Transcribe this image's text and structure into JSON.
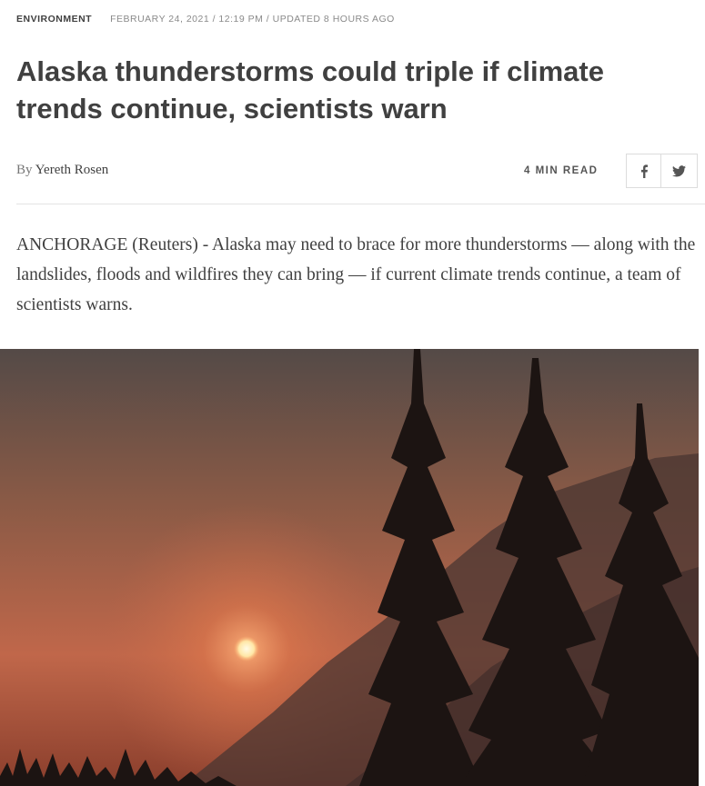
{
  "article": {
    "section": "ENVIRONMENT",
    "timestamp": "FEBRUARY 24, 2021 / 12:19 PM / UPDATED 8 HOURS AGO",
    "headline": "Alaska thunderstorms could triple if climate trends continue, scientists warn",
    "byline_prefix": "By",
    "author": "Yereth Rosen",
    "read_time": "4 MIN READ",
    "lede": "ANCHORAGE (Reuters) - Alaska may need to brace for more thunderstorms — along with the landslides, floods and wildfires they can bring — if current climate trends continue, a team of scientists warns."
  },
  "share": {
    "facebook_icon": "facebook-icon",
    "twitter_icon": "twitter-icon"
  },
  "colors": {
    "text": "#404040",
    "muted": "#8a8a8a",
    "sky_top": "#5a4e4a",
    "sky_glow": "#e07a4e",
    "sun": "#fff3c8"
  }
}
